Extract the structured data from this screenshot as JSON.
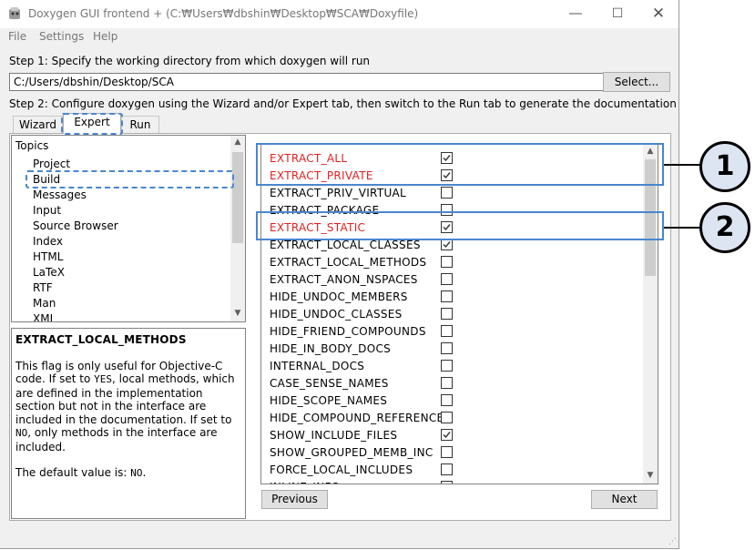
{
  "window": {
    "title": "Doxygen GUI frontend + (C:₩Users₩dbshin₩Desktop₩SCA₩Doxyfile)",
    "minimize_icon": "minimize-icon",
    "maximize_icon": "maximize-icon",
    "close_icon": "close-icon"
  },
  "menu": [
    "File",
    "Settings",
    "Help"
  ],
  "step1": {
    "label": "Step 1: Specify the working directory from which doxygen will run",
    "path_value": "C:/Users/dbshin/Desktop/SCA",
    "select_button": "Select..."
  },
  "step2": {
    "label": "Step 2: Configure doxygen using the Wizard and/or Expert tab, then switch to the Run tab to generate the documentation"
  },
  "tabs": [
    {
      "label": "Wizard",
      "active": false
    },
    {
      "label": "Expert",
      "active": true
    },
    {
      "label": "Run",
      "active": false
    }
  ],
  "topics": {
    "header": "Topics",
    "items": [
      "Project",
      "Build",
      "Messages",
      "Input",
      "Source Browser",
      "Index",
      "HTML",
      "LaTeX",
      "RTF",
      "Man",
      "XML"
    ],
    "selected": "Build"
  },
  "help": {
    "title": "EXTRACT_LOCAL_METHODS",
    "p1_a": "This flag is only useful for Objective-C code. If set to ",
    "p1_yes": "YES",
    "p1_b": ", local methods, which are defined in the implementation section but not in the interface are included in the documentation. If set to ",
    "p1_no": "NO",
    "p1_c": ", only methods in the interface are included.",
    "p2_a": "The default value is: ",
    "p2_val": "NO",
    "p2_b": "."
  },
  "options": [
    {
      "name": "EXTRACT_ALL",
      "checked": true,
      "modified": true
    },
    {
      "name": "EXTRACT_PRIVATE",
      "checked": true,
      "modified": true
    },
    {
      "name": "EXTRACT_PRIV_VIRTUAL",
      "checked": false,
      "modified": false
    },
    {
      "name": "EXTRACT_PACKAGE",
      "checked": false,
      "modified": false
    },
    {
      "name": "EXTRACT_STATIC",
      "checked": true,
      "modified": true
    },
    {
      "name": "EXTRACT_LOCAL_CLASSES",
      "checked": true,
      "modified": false
    },
    {
      "name": "EXTRACT_LOCAL_METHODS",
      "checked": false,
      "modified": false
    },
    {
      "name": "EXTRACT_ANON_NSPACES",
      "checked": false,
      "modified": false
    },
    {
      "name": "HIDE_UNDOC_MEMBERS",
      "checked": false,
      "modified": false
    },
    {
      "name": "HIDE_UNDOC_CLASSES",
      "checked": false,
      "modified": false
    },
    {
      "name": "HIDE_FRIEND_COMPOUNDS",
      "checked": false,
      "modified": false
    },
    {
      "name": "HIDE_IN_BODY_DOCS",
      "checked": false,
      "modified": false
    },
    {
      "name": "INTERNAL_DOCS",
      "checked": false,
      "modified": false
    },
    {
      "name": "CASE_SENSE_NAMES",
      "checked": false,
      "modified": false
    },
    {
      "name": "HIDE_SCOPE_NAMES",
      "checked": false,
      "modified": false
    },
    {
      "name": "HIDE_COMPOUND_REFERENCE",
      "checked": false,
      "modified": false
    },
    {
      "name": "SHOW_INCLUDE_FILES",
      "checked": true,
      "modified": false
    },
    {
      "name": "SHOW_GROUPED_MEMB_INC",
      "checked": false,
      "modified": false
    },
    {
      "name": "FORCE_LOCAL_INCLUDES",
      "checked": false,
      "modified": false
    },
    {
      "name": "INLINE_INFO",
      "checked": true,
      "modified": false
    }
  ],
  "nav": {
    "previous": "Previous",
    "next": "Next"
  },
  "callouts": [
    {
      "number": "1"
    },
    {
      "number": "2"
    }
  ],
  "colors": {
    "modified": "#e02020",
    "highlight": "#4a86d0",
    "callout_fill": "#dde4f2"
  }
}
